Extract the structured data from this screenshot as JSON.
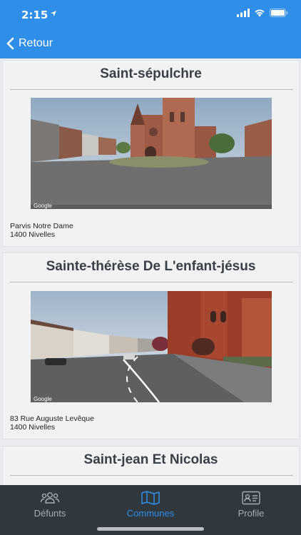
{
  "status": {
    "time": "2:15"
  },
  "nav": {
    "back_label": "Retour"
  },
  "cards": [
    {
      "title": "Saint-sépulchre",
      "address_line1": "Parvis Notre Dame",
      "address_line2": "1400 Nivelles",
      "watermark": "Google"
    },
    {
      "title": "Sainte-thérèse De L'enfant-jésus",
      "address_line1": "83 Rue Auguste Levêque",
      "address_line2": "1400 Nivelles",
      "watermark": "Google"
    },
    {
      "title": "Saint-jean Et Nicolas"
    }
  ],
  "tabs": [
    {
      "label": "Défunts",
      "icon": "users-icon"
    },
    {
      "label": "Communes",
      "icon": "map-icon",
      "active": true
    },
    {
      "label": "Profile",
      "icon": "id-card-icon"
    }
  ],
  "colors": {
    "accent": "#2f8fe8",
    "tabbar": "#30373d",
    "inactive_tab": "#a5adb5"
  }
}
